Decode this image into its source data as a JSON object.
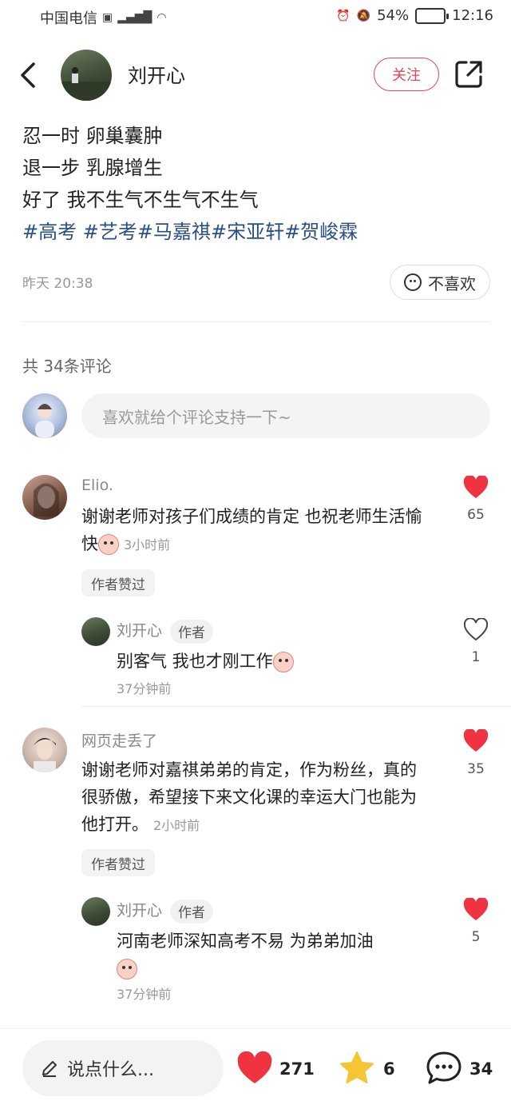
{
  "status_bar": {
    "carrier": "中国电信",
    "network_icons": [
      "hd-icon",
      "4g-icon",
      "signal-icon",
      "wifi-icon"
    ],
    "battery_percent": "54%",
    "time": "12:16"
  },
  "header": {
    "author_name": "刘开心",
    "follow_label": "关注"
  },
  "post": {
    "lines": [
      "忍一时 卵巢囊肿",
      "退一步 乳腺增生",
      "好了 我不生气不生气不生气"
    ],
    "hashtags": "#高考 #艺考#马嘉祺#宋亚轩#贺峻霖",
    "timestamp": "昨天 20:38",
    "dislike_label": "不喜欢"
  },
  "comments_section": {
    "count_label": "共 34条评论",
    "input_placeholder": "喜欢就给个评论支持一下~"
  },
  "comments": [
    {
      "user": "Elio.",
      "text": "谢谢老师对孩子们成绩的肯定 也祝老师生活愉快",
      "time": "3小时前",
      "likes": "65",
      "liked": true,
      "liked_tag": "作者赞过",
      "reply": {
        "user": "刘开心",
        "author_tag": "作者",
        "text": "别客气 我也才刚工作",
        "time": "37分钟前",
        "likes": "1",
        "liked": false
      }
    },
    {
      "user": "网页走丢了",
      "text": "谢谢老师对嘉祺弟弟的肯定，作为粉丝，真的很骄傲，希望接下来文化课的幸运大门也能为他打开。",
      "time": "2小时前",
      "likes": "35",
      "liked": true,
      "liked_tag": "作者赞过",
      "reply": {
        "user": "刘开心",
        "author_tag": "作者",
        "text": "河南老师深知高考不易 为弟弟加油",
        "time": "37分钟前",
        "likes": "5",
        "liked": true
      }
    }
  ],
  "bottom_bar": {
    "input_label": "说点什么...",
    "likes": "271",
    "stars": "6",
    "comments": "34"
  },
  "colors": {
    "accent": "#e8445a",
    "hashtag": "#2a4f86",
    "heart": "#ef3341",
    "star": "#f5c534"
  }
}
